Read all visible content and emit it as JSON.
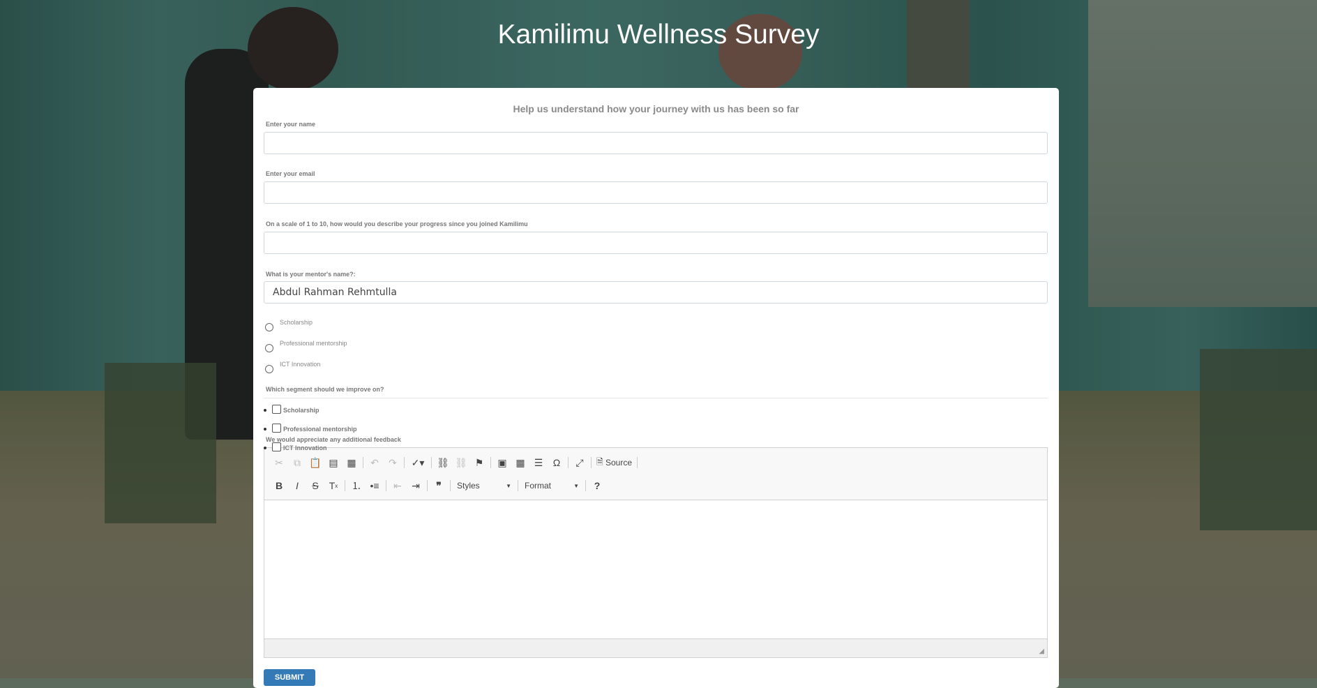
{
  "page": {
    "title": "Kamilimu Wellness Survey"
  },
  "form": {
    "subtitle": "Help us understand how your journey with us has been so far",
    "name": {
      "label": "Enter your name",
      "value": ""
    },
    "email": {
      "label": "Enter your email",
      "value": ""
    },
    "progress": {
      "label": "On a scale of 1 to 10, how would you describe your progress since you joined Kamilimu",
      "value": ""
    },
    "mentor": {
      "label": "What is your mentor's name?:",
      "value": "Abdul Rahman Rehmtulla"
    },
    "radio_options": [
      "Scholarship",
      "Professional mentorship",
      "ICT Innovation"
    ],
    "improve": {
      "label": "Which segment should we improve on?",
      "options": [
        "Scholarship",
        "Professional mentorship",
        "ICT Innovation"
      ]
    },
    "feedback": {
      "label": "We would appreciate any additional feedback"
    },
    "submit_label": "SUBMIT"
  },
  "editor": {
    "row1": [
      "cut-icon",
      "copy-icon",
      "paste-icon",
      "paste-text-icon",
      "paste-word-icon",
      "undo-icon",
      "redo-icon",
      "spellcheck-icon",
      "link-icon",
      "unlink-icon",
      "anchor-icon",
      "image-icon",
      "table-icon",
      "horizontal-line-icon",
      "special-char-icon",
      "maximize-icon",
      "source-icon"
    ],
    "source_label": "Source",
    "row2": [
      "bold-icon",
      "italic-icon",
      "strike-icon",
      "remove-format-icon",
      "numbered-list-icon",
      "bulleted-list-icon",
      "outdent-icon",
      "indent-icon",
      "blockquote-icon",
      "help-icon"
    ],
    "styles_label": "Styles",
    "format_label": "Format"
  }
}
